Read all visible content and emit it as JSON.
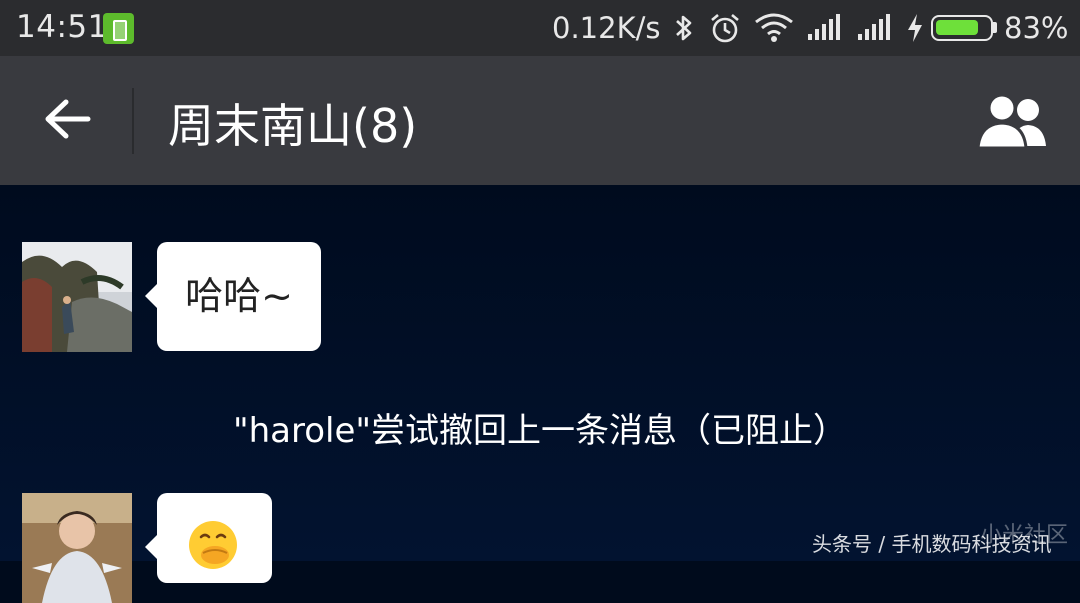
{
  "status_bar": {
    "time": "14:51",
    "network_speed": "0.12K/s",
    "battery_percent": "83%",
    "battery_level": 0.83,
    "icons": [
      "battery-app-icon",
      "bluetooth-icon",
      "alarm-icon",
      "wifi-icon",
      "signal-icon",
      "signal-icon",
      "charging-icon",
      "battery-icon"
    ]
  },
  "header": {
    "title": "周末南山(8)",
    "back_icon": "arrow-left-icon",
    "members_icon": "group-members-icon"
  },
  "messages": [
    {
      "type": "incoming",
      "text": "哈哈~",
      "avatar": "avatar-photo-outdoor"
    },
    {
      "type": "system",
      "text": "\"harole\"尝试撤回上一条消息（已阻止）"
    },
    {
      "type": "incoming",
      "emoji": "🤭",
      "avatar": "avatar-photo-girl"
    }
  ],
  "watermark": {
    "text": "头条号 / 手机数码科技资讯",
    "faint_text": "小米社区"
  },
  "colors": {
    "status_bar_bg": "#2b2c2f",
    "title_bar_bg": "#393a3f",
    "chat_bg": "#000b1c",
    "bubble_bg": "#ffffff",
    "battery_fill": "#6ee03a"
  }
}
